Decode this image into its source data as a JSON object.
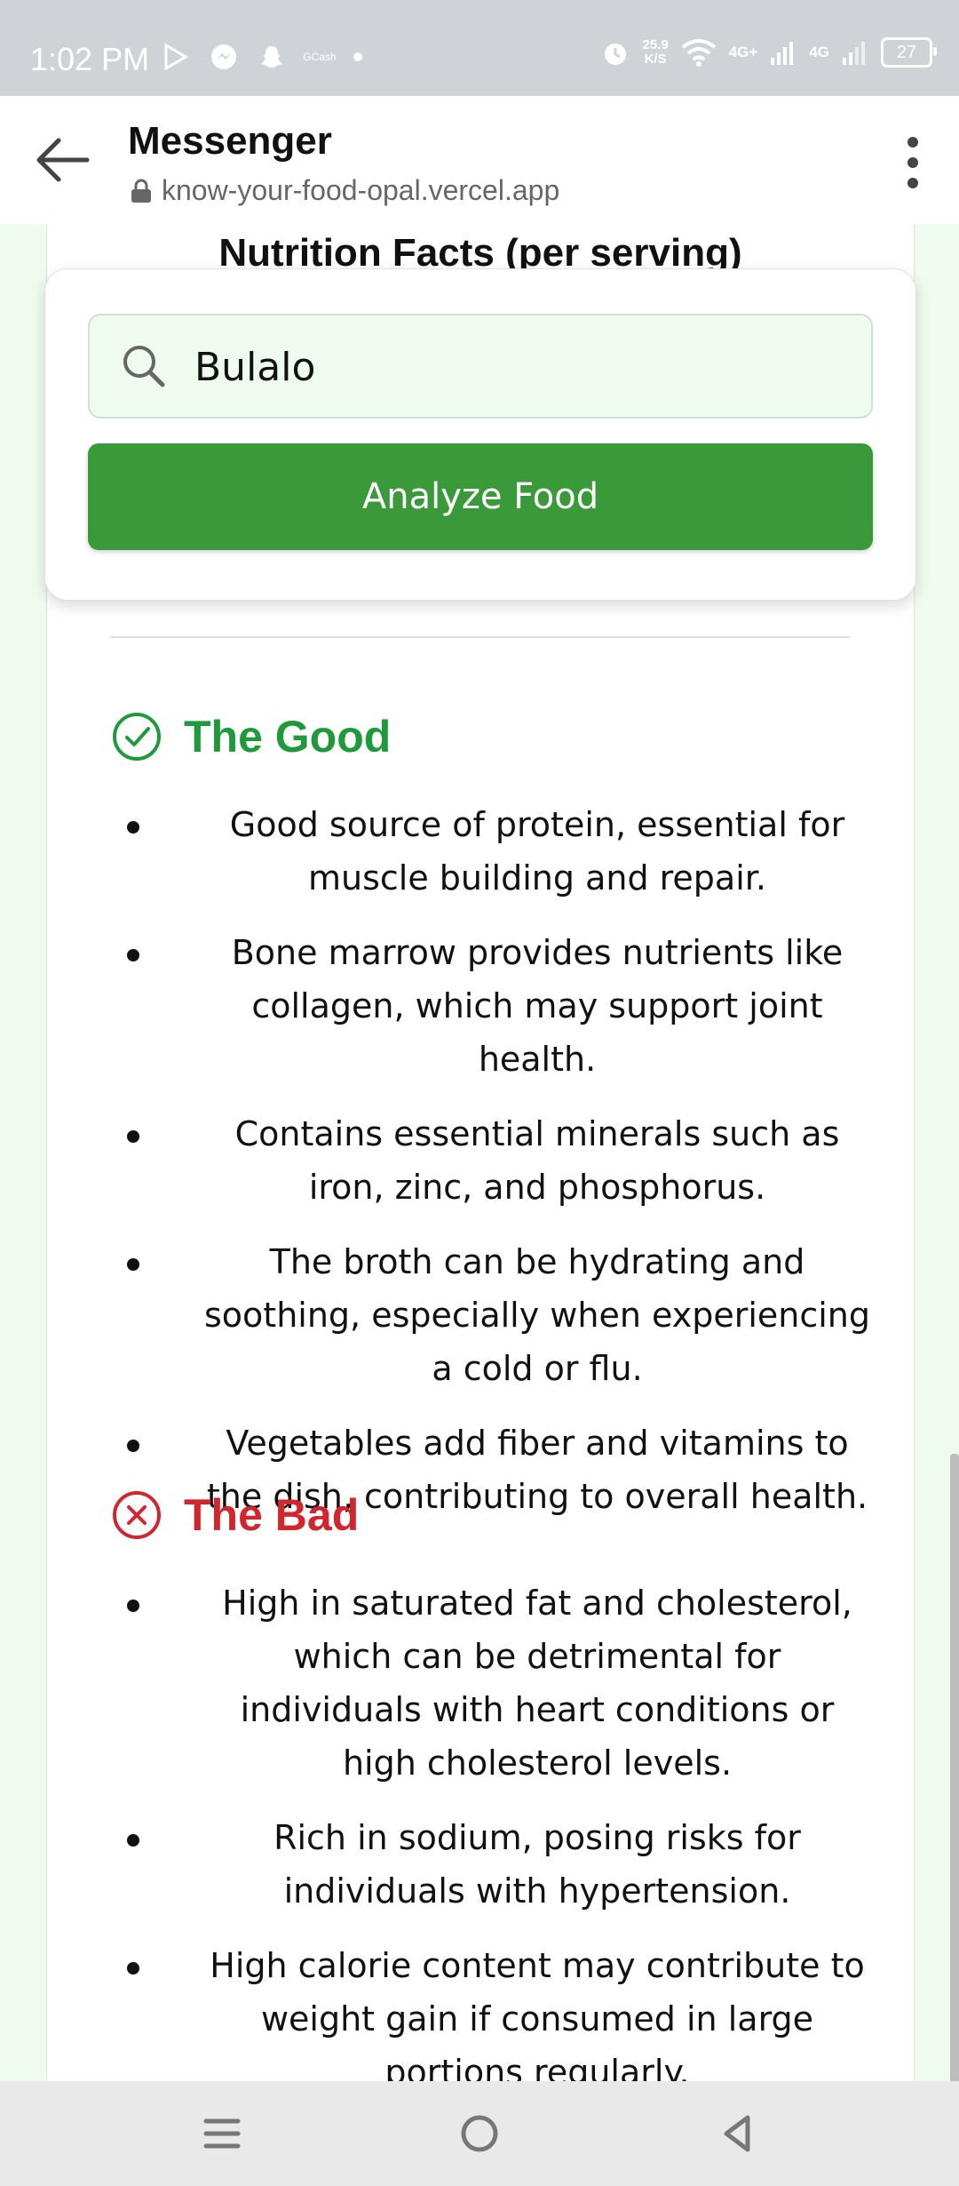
{
  "status_bar": {
    "time": "1:02 PM",
    "small_app_label": "GCash",
    "speed": "25.9",
    "speed_unit": "K/S",
    "net1": "4G+",
    "net2": "4G",
    "battery": "27"
  },
  "app_bar": {
    "title": "Messenger",
    "url": "know-your-food-opal.vercel.app"
  },
  "content": {
    "nutrition_title": "Nutrition Facts (per serving)",
    "search_value": "Bulalo",
    "analyze_label": "Analyze Food",
    "good_heading": "The Good",
    "good_items": [
      "Good source of protein, essential for muscle building and repair.",
      "Bone marrow provides nutrients like collagen, which may support joint health.",
      "Contains essential minerals such as iron, zinc, and phosphorus.",
      "The broth can be hydrating and soothing, especially when experiencing a cold or flu.",
      "Vegetables add fiber and vitamins to the dish, contributing to overall health."
    ],
    "bad_heading": "The Bad",
    "bad_items": [
      "High in saturated fat and cholesterol, which can be detrimental for individuals with heart conditions or high cholesterol levels.",
      "Rich in sodium, posing risks for individuals with hypertension.",
      "High calorie content may contribute to weight gain if consumed in large portions regularly."
    ]
  },
  "colors": {
    "good": "#1f9a3a",
    "bad": "#d2262e",
    "button": "#3a9a3a",
    "page_bg": "#eefbee"
  },
  "icons": {
    "back": "arrow-left-icon",
    "more": "kebab-menu-icon",
    "search": "search-icon",
    "good": "check-circle-icon",
    "bad": "x-circle-icon"
  }
}
